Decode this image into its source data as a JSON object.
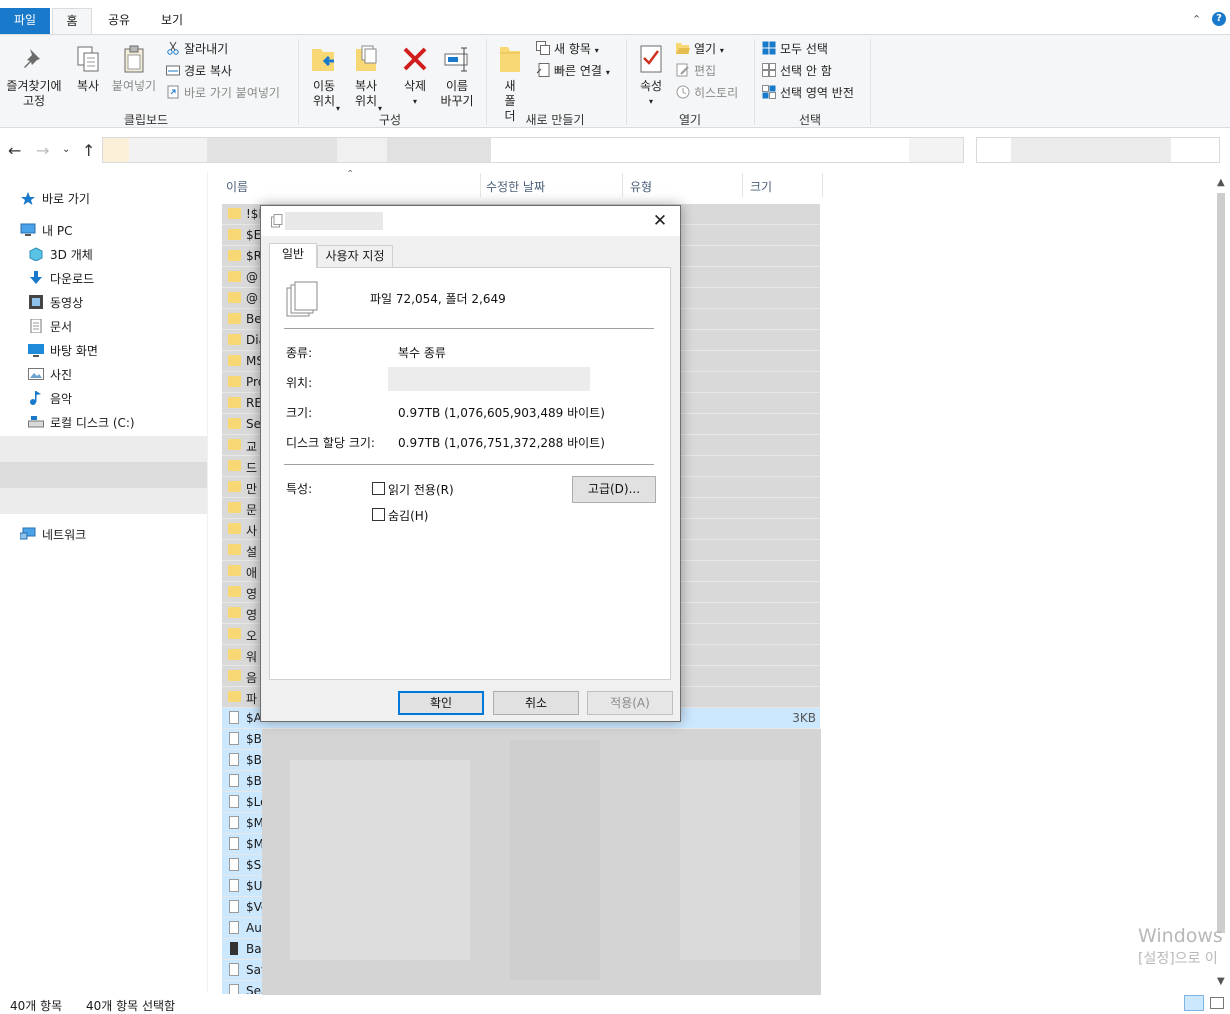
{
  "ribbon_tabs": [
    "파일",
    "홈",
    "공유",
    "보기"
  ],
  "clipboard": {
    "pin_label": "즐겨찾기에 고정",
    "copy_label": "복사",
    "paste_label": "붙여넣기",
    "cut_label": "잘라내기",
    "copy_path_label": "경로 복사",
    "paste_shortcut_label": "바로 가기 붙여넣기",
    "group_label": "클립보드"
  },
  "organize": {
    "move_to_label": "이동 위치",
    "copy_to_label": "복사 위치",
    "delete_label": "삭제",
    "rename_label": "이름 바꾸기",
    "group_label": "구성"
  },
  "new": {
    "new_folder_label": "새 폴더",
    "new_item_label": "새 항목",
    "easy_access_label": "빠른 연결",
    "group_label": "새로 만들기"
  },
  "open": {
    "properties_label": "속성",
    "open_label": "열기",
    "edit_label": "편집",
    "history_label": "히스토리",
    "group_label": "열기"
  },
  "select": {
    "select_all_label": "모두 선택",
    "select_none_label": "선택 안 함",
    "invert_label": "선택 영역 반전",
    "group_label": "선택"
  },
  "nav_pane": {
    "quick_access": "바로 가기",
    "this_pc": "내 PC",
    "objects_3d": "3D 개체",
    "downloads": "다운로드",
    "videos": "동영상",
    "documents": "문서",
    "desktop": "바탕 화면",
    "pictures": "사진",
    "music": "음악",
    "local_disk": "로컬 디스크 (C:)",
    "network": "네트워크"
  },
  "columns": {
    "name": "이름",
    "modified": "수정한 날짜",
    "type": "유형",
    "size": "크기"
  },
  "files": [
    {
      "name": "!$F",
      "kind": "folder"
    },
    {
      "name": "$E",
      "kind": "folder"
    },
    {
      "name": "$R",
      "kind": "folder"
    },
    {
      "name": "@",
      "kind": "folder"
    },
    {
      "name": "@",
      "kind": "folder"
    },
    {
      "name": "Be",
      "kind": "folder"
    },
    {
      "name": "Dia",
      "kind": "folder"
    },
    {
      "name": "MS",
      "kind": "folder"
    },
    {
      "name": "Pro",
      "kind": "folder"
    },
    {
      "name": "RE",
      "kind": "folder"
    },
    {
      "name": "Se",
      "kind": "folder"
    },
    {
      "name": "교",
      "kind": "folder"
    },
    {
      "name": "드",
      "kind": "folder"
    },
    {
      "name": "만",
      "kind": "folder"
    },
    {
      "name": "문",
      "kind": "folder"
    },
    {
      "name": "사",
      "kind": "folder"
    },
    {
      "name": "설",
      "kind": "folder"
    },
    {
      "name": "애",
      "kind": "folder"
    },
    {
      "name": "영",
      "kind": "folder"
    },
    {
      "name": "영",
      "kind": "folder"
    },
    {
      "name": "오",
      "kind": "folder"
    },
    {
      "name": "워",
      "kind": "folder"
    },
    {
      "name": "음",
      "kind": "folder"
    },
    {
      "name": "파",
      "kind": "folder"
    },
    {
      "name": "$A",
      "kind": "doc",
      "size": "3KB"
    },
    {
      "name": "$Ba",
      "kind": "doc"
    },
    {
      "name": "$Bl",
      "kind": "doc"
    },
    {
      "name": "$Bo",
      "kind": "doc"
    },
    {
      "name": "$Lo",
      "kind": "doc"
    },
    {
      "name": "$M",
      "kind": "doc"
    },
    {
      "name": "$M",
      "kind": "doc"
    },
    {
      "name": "$Se",
      "kind": "doc"
    },
    {
      "name": "$Up",
      "kind": "doc"
    },
    {
      "name": "$Vo",
      "kind": "doc"
    },
    {
      "name": "Aut",
      "kind": "doc"
    },
    {
      "name": "Bac",
      "kind": "blk"
    },
    {
      "name": "Sav",
      "kind": "doc"
    },
    {
      "name": "Sea",
      "kind": "doc"
    }
  ],
  "status": {
    "item_count": "40개 항목",
    "selected_count": "40개 항목 선택함"
  },
  "dialog": {
    "tab_general": "일반",
    "tab_custom": "사용자 지정",
    "summary": "파일 72,054, 폴더 2,649",
    "type_label": "종류:",
    "type_value": "복수 종류",
    "location_label": "위치:",
    "size_label": "크기:",
    "size_value": "0.97TB (1,076,605,903,489 바이트)",
    "disk_size_label": "디스크 할당 크기:",
    "disk_size_value": "0.97TB (1,076,751,372,288 바이트)",
    "attributes_label": "특성:",
    "readonly_label": "읽기 전용(R)",
    "hidden_label": "숨김(H)",
    "advanced_label": "고급(D)...",
    "ok_label": "확인",
    "cancel_label": "취소",
    "apply_label": "적용(A)"
  },
  "watermark": {
    "line1": "Windows",
    "line2": "[설정]으로 이"
  },
  "colors": {
    "accent": "#1979ca",
    "folder": "#f8d775",
    "selection": "#cce8ff"
  }
}
